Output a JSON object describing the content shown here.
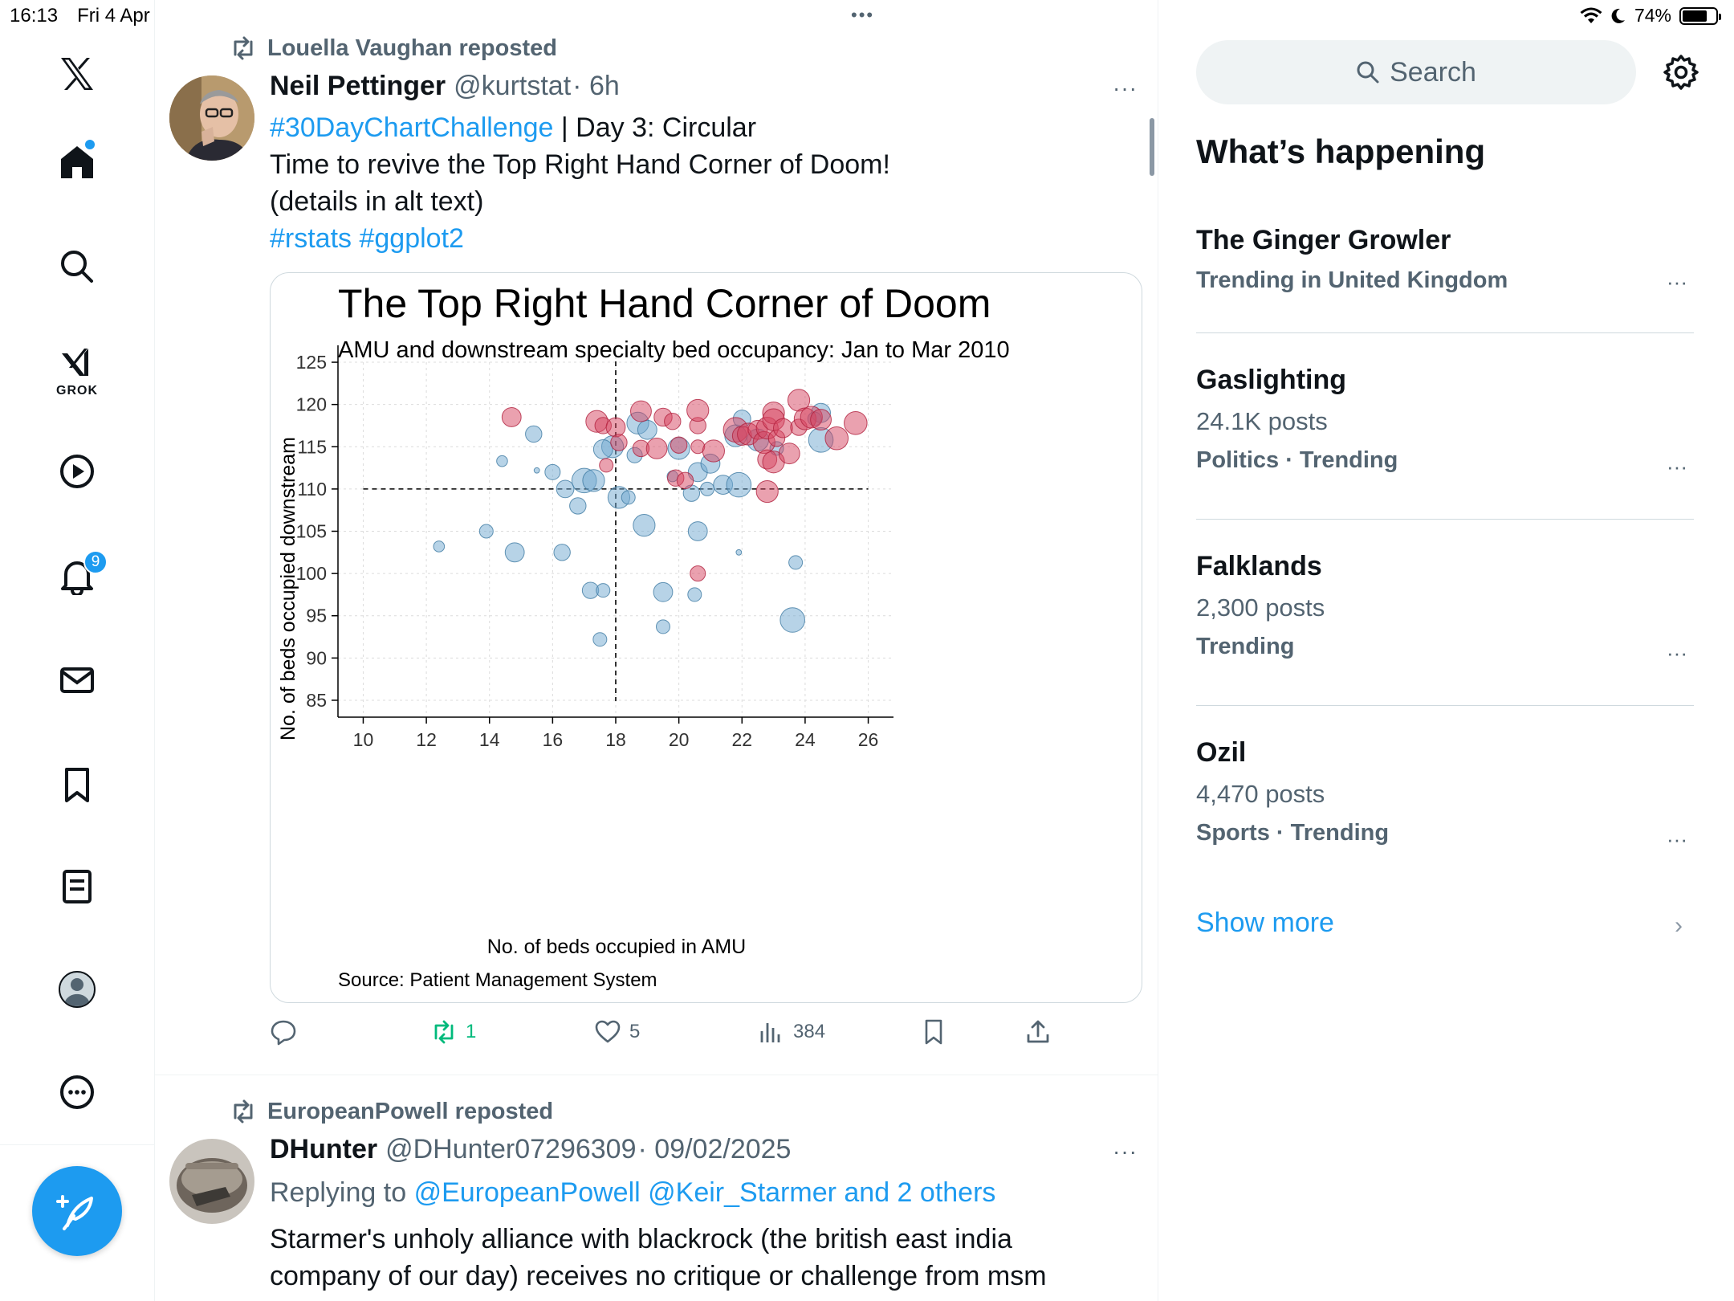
{
  "status_bar": {
    "time": "16:13",
    "date": "Fri 4 Apr",
    "battery": "74%",
    "battery_level": 0.74
  },
  "nav": {
    "items": [
      "X logo",
      "Home",
      "Explore",
      "Grok",
      "Video",
      "Notifications",
      "Messages",
      "Bookmarks",
      "Lists",
      "Profile",
      "More"
    ],
    "grok_label": "GROK",
    "notifications_badge": "9"
  },
  "post1": {
    "repost_by": "Louella Vaughan reposted",
    "name": "Neil Pettinger",
    "handle": "@kurtstat",
    "time": "· 6h",
    "more": "···",
    "hashtag_main": "#30DayChartChallenge",
    "text_line1_rest": " | Day 3: Circular",
    "text_line2": "Time to revive the Top Right Hand Corner of Doom!",
    "text_line3": "(details in alt text)",
    "text_line4": "#rstats #ggplot2",
    "actions": {
      "replies": "",
      "reposts": "1",
      "likes": "5",
      "views": "384"
    },
    "accent_repost_color": "#00ba7c"
  },
  "chart_data": {
    "type": "scatter",
    "title": "The Top Right Hand Corner of Doom",
    "subtitle": "AMU and downstream specialty bed occupancy: Jan to Mar 2010",
    "xlabel": "No. of beds occupied in AMU",
    "ylabel": "No. of beds occupied downstream",
    "source": "Source: Patient Management System",
    "xlim": [
      9.2,
      26.8
    ],
    "ylim": [
      83,
      127
    ],
    "xticks": [
      10,
      12,
      14,
      16,
      18,
      20,
      22,
      24,
      26
    ],
    "yticks": [
      85,
      90,
      95,
      100,
      105,
      110,
      115,
      120,
      125
    ],
    "reference_lines": {
      "x": 18,
      "y": 110
    },
    "grid": true,
    "colors": {
      "doom": "#d6445f",
      "ok": "#6fa8cf"
    },
    "series": [
      {
        "name": "",
        "color": "#6fa8cf",
        "points": [
          [
            12.4,
            103.2,
            2
          ],
          [
            13.9,
            105,
            2.5
          ],
          [
            14.4,
            113.3,
            2
          ],
          [
            14.8,
            102.5,
            3.5
          ],
          [
            15.4,
            116.5,
            3
          ],
          [
            15.5,
            112.2,
            1
          ],
          [
            16,
            112,
            2.8
          ],
          [
            16.3,
            102.5,
            3
          ],
          [
            16.4,
            110,
            3.2
          ],
          [
            16.8,
            108,
            3
          ],
          [
            17,
            111,
            4.5
          ],
          [
            17.3,
            111,
            4
          ],
          [
            17.2,
            98,
            3
          ],
          [
            17.6,
            98,
            2.5
          ],
          [
            17.5,
            92.2,
            2.5
          ],
          [
            17.9,
            115,
            4
          ],
          [
            17.6,
            114.7,
            3.5
          ],
          [
            18.1,
            109,
            4
          ],
          [
            18.4,
            109,
            2.5
          ],
          [
            18.6,
            114,
            2.8
          ],
          [
            18.7,
            117.8,
            4
          ],
          [
            18.9,
            105.7,
            4
          ],
          [
            19.0,
            117,
            3.5
          ],
          [
            19.5,
            97.8,
            3.5
          ],
          [
            19.5,
            93.7,
            2.5
          ],
          [
            20.0,
            114.8,
            4
          ],
          [
            19.8,
            111.5,
            2
          ],
          [
            20.4,
            109.5,
            3
          ],
          [
            20.5,
            97.5,
            2.5
          ],
          [
            20.6,
            105,
            3.5
          ],
          [
            20.6,
            112,
            3.5
          ],
          [
            20.9,
            110,
            2.5
          ],
          [
            21.0,
            113,
            3.5
          ],
          [
            21.4,
            110.5,
            3.5
          ],
          [
            21.8,
            116.3,
            4
          ],
          [
            21.9,
            102.5,
            1
          ],
          [
            21.9,
            110.5,
            4.5
          ],
          [
            22.0,
            118.3,
            3.2
          ],
          [
            22.5,
            115.8,
            4
          ],
          [
            23.1,
            114.8,
            2.5
          ],
          [
            23.6,
            94.5,
            4.5
          ],
          [
            23.7,
            101.3,
            2.5
          ],
          [
            24.5,
            119,
            3.5
          ],
          [
            24.5,
            115.8,
            4.5
          ],
          [
            24.3,
            118.3,
            2.5
          ]
        ]
      },
      {
        "name": "",
        "color": "#d6445f",
        "points": [
          [
            14.7,
            118.5,
            3.5
          ],
          [
            17.4,
            118,
            4
          ],
          [
            17.6,
            117.5,
            3
          ],
          [
            17.7,
            112.8,
            2.5
          ],
          [
            18.0,
            117.3,
            3.5
          ],
          [
            18.1,
            115.5,
            3
          ],
          [
            18.8,
            119.2,
            3.8
          ],
          [
            18.8,
            114.8,
            3
          ],
          [
            19.3,
            114.8,
            3.8
          ],
          [
            19.5,
            118.5,
            3.3
          ],
          [
            19.8,
            118,
            3
          ],
          [
            20.0,
            115.2,
            3
          ],
          [
            19.9,
            111.3,
            3
          ],
          [
            20.2,
            111,
            3
          ],
          [
            20.6,
            117.5,
            3
          ],
          [
            20.6,
            115,
            2.5
          ],
          [
            20.6,
            119.3,
            4
          ],
          [
            21.1,
            114.5,
            4
          ],
          [
            21.8,
            117,
            4.5
          ],
          [
            22.0,
            116.3,
            3.5
          ],
          [
            22.2,
            116.5,
            4
          ],
          [
            22.5,
            117,
            3.5
          ],
          [
            22.7,
            115.5,
            4
          ],
          [
            22.8,
            117.2,
            4
          ],
          [
            22.8,
            113.5,
            3.5
          ],
          [
            23.0,
            119,
            4
          ],
          [
            23.0,
            118.2,
            4
          ],
          [
            23.1,
            116,
            3
          ],
          [
            23.3,
            117.2,
            3.5
          ],
          [
            23.0,
            113.2,
            4
          ],
          [
            22.8,
            109.7,
            4
          ],
          [
            23.5,
            114.2,
            3.8
          ],
          [
            23.8,
            120.5,
            4
          ],
          [
            23.8,
            117.3,
            3
          ],
          [
            24.0,
            118.3,
            4
          ],
          [
            24.2,
            118.5,
            4
          ],
          [
            24.5,
            118.2,
            3.8
          ],
          [
            25.0,
            116,
            4.2
          ],
          [
            25.6,
            117.8,
            4.2
          ],
          [
            20.6,
            100,
            2.8
          ]
        ]
      }
    ]
  },
  "post2": {
    "repost_by": "EuropeanPowell reposted",
    "name": "DHunter",
    "handle": "@DHunter07296309",
    "time": "· 09/02/2025",
    "more": "···",
    "replying_prefix": "Replying to",
    "replying_targets": "@EuropeanPowell @Keir_Starmer and 2 others",
    "text_line1": "Starmer's unholy alliance with blackrock (the british east india",
    "text_line2": "company of our day) receives no critique or challenge from msm"
  },
  "right": {
    "search_placeholder": "Search",
    "whats_happening": "What’s happening",
    "trends": [
      {
        "name": "The Ginger Growler",
        "posts": "",
        "meta": "Trending in United Kingdom"
      },
      {
        "name": "Gaslighting",
        "posts": "24.1K posts",
        "meta": "Politics · Trending"
      },
      {
        "name": "Falklands",
        "posts": "2,300 posts",
        "meta": "Trending"
      },
      {
        "name": "Ozil",
        "posts": "4,470 posts",
        "meta": "Sports · Trending"
      }
    ],
    "more": "···",
    "show_more": "Show more"
  }
}
